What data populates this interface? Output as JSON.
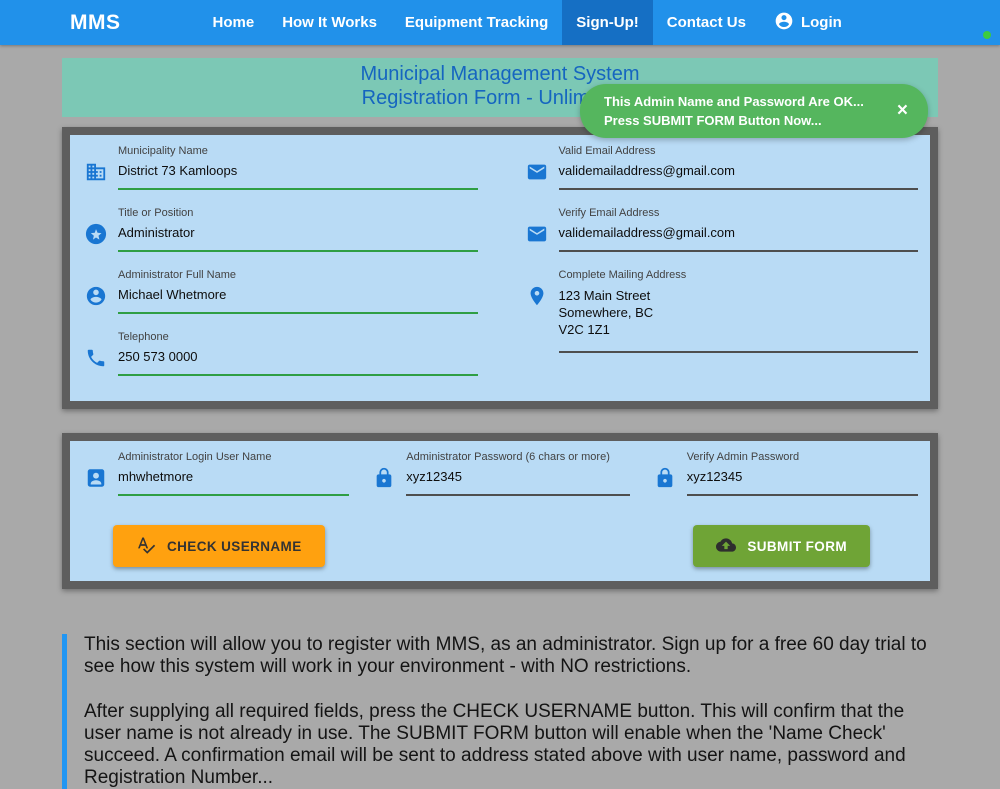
{
  "navbar": {
    "brand": "MMS",
    "items": [
      {
        "label": "Home"
      },
      {
        "label": "How It Works"
      },
      {
        "label": "Equipment Tracking"
      },
      {
        "label": "Sign-Up!",
        "active": true
      },
      {
        "label": "Contact Us"
      }
    ],
    "login_label": "Login"
  },
  "banner": {
    "title1": "Municipal Management System",
    "title2": "Registration Form - Unlimited 6"
  },
  "toast": {
    "line1": "This Admin Name and Password Are OK...",
    "line2": "Press SUBMIT FORM Button Now...",
    "close": "×"
  },
  "form_contact": {
    "left_fields": [
      {
        "label": "Municipality Name",
        "value": "District 73 Kamloops",
        "icon": "building-icon",
        "underline": "green"
      },
      {
        "label": "Title or Position",
        "value": "Administrator",
        "icon": "star-circle-icon",
        "underline": "green"
      },
      {
        "label": "Administrator Full Name",
        "value": "Michael Whetmore",
        "icon": "person-circle-icon",
        "underline": "green"
      },
      {
        "label": "Telephone",
        "value": "250 573 0000",
        "icon": "phone-icon",
        "underline": "green"
      }
    ],
    "right_fields": [
      {
        "label": "Valid Email Address",
        "value": "validemailaddress@gmail.com",
        "icon": "email-icon",
        "underline": "dark"
      },
      {
        "label": "Verify Email Address",
        "value": "validemailaddress@gmail.com",
        "icon": "email-icon",
        "underline": "dark"
      },
      {
        "label": "Complete Mailing Address",
        "lines": [
          "123 Main Street",
          "Somewhere, BC",
          "V2C 1Z1"
        ],
        "icon": "location-pin-icon",
        "underline": "dark"
      }
    ]
  },
  "form_login": {
    "fields": [
      {
        "label": "Administrator Login User Name",
        "value": "mhwhetmore",
        "icon": "id-card-icon",
        "underline": "green"
      },
      {
        "label": "Administrator Password (6 chars or more)",
        "value": "xyz12345",
        "icon": "lock-icon",
        "underline": "dark"
      },
      {
        "label": "Verify Admin Password",
        "value": "xyz12345",
        "icon": "lock-icon",
        "underline": "dark"
      }
    ],
    "check_username_label": "CHECK USERNAME",
    "submit_form_label": "SUBMIT FORM"
  },
  "info": {
    "paragraph1": "This section will allow you to register with MMS, as an administrator. Sign up for a free 60 day trial to see how this system will work in your environment - with NO restrictions.",
    "paragraph2": "After supplying all required fields, press the CHECK USERNAME button. This will confirm that the user name is not already in use. The SUBMIT FORM button will enable when the 'Name Check' succeed. A confirmation email will be sent to address stated above with user name, password and Registration Number..."
  },
  "colors": {
    "navbar_blue": "#2191EA",
    "active_blue": "#156FC4",
    "banner_teal": "#7CC8B5",
    "banner_text_blue": "#1565C0",
    "toast_green": "#55B65E",
    "card_blue": "#B9DBF5",
    "icon_blue": "#1976D2",
    "underline_green": "#2F9E44",
    "underline_dark": "#4E4E4E",
    "button_orange": "#FFA10F",
    "button_green": "#6FA436",
    "page_gray": "#A9A9A9"
  }
}
